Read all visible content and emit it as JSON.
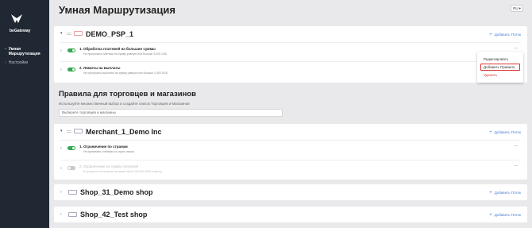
{
  "sidebar": {
    "logo_text": "beGateway",
    "active_item": "Умная Маршрутизация",
    "sub_item": "Настройки"
  },
  "header": {
    "title": "Умная Маршрутизация",
    "lang": "RU"
  },
  "colors": {
    "sidebar_bg": "#1f2833",
    "accent": "#4a7bd0",
    "toggle_on": "#34a853",
    "danger": "#d33333"
  },
  "add_flow_label": "Добавить Поток",
  "cards": {
    "psp": {
      "title": "DEMO_PSP_1",
      "rules": [
        {
          "title": "1. Обработка платежей на большие суммы",
          "desc": "Не пропускать платежи на сумму равную или больше 3,000 USD",
          "enabled": true
        },
        {
          "title": "2. Лимиты на выплаты",
          "desc": "Не пропускать выплаты на сумму равную или больше 2,000 USD",
          "enabled": true
        }
      ]
    },
    "merchant": {
      "title": "Merchant_1_Demo Inc",
      "rules": [
        {
          "title": "1. Ограничение по странам",
          "desc": "Не принимать платежи из стран списка",
          "enabled": true
        },
        {
          "title": "2. Ограничение на сумму платежей",
          "desc": "В процессе отклонения не может быть 100,000 USD в месяц",
          "enabled": false
        }
      ]
    },
    "shop31": {
      "title": "Shop_31_Demo shop"
    },
    "shop42": {
      "title": "Shop_42_Test shop"
    }
  },
  "section": {
    "title": "Правила для торговцев и магазинов",
    "hint": "Используйте множественный выбор и создайте список Торговцев и Магазинов",
    "select_placeholder": "Выберите торговцев и магазины"
  },
  "menu": {
    "edit": "Редактировать",
    "add_rule": "Добавить Правило",
    "delete": "Удалить"
  }
}
